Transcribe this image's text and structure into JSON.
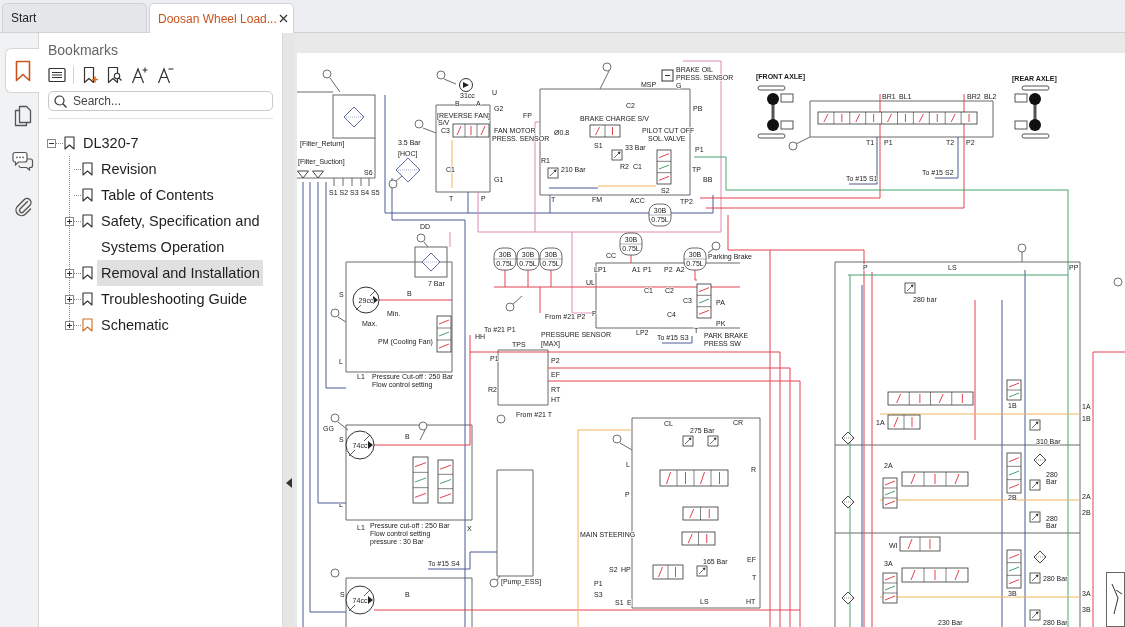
{
  "tabs": [
    {
      "label": "Start",
      "selected": false,
      "closable": false
    },
    {
      "label": "Doosan Wheel Load...",
      "selected": true,
      "closable": true
    }
  ],
  "sidebar_tabs": [
    {
      "kind": "bookmarks",
      "selected": true
    },
    {
      "kind": "pages",
      "selected": false
    },
    {
      "kind": "comments",
      "selected": false
    },
    {
      "kind": "attachments",
      "selected": false
    }
  ],
  "bookmarks": {
    "title": "Bookmarks",
    "search": {
      "placeholder": "Search..."
    },
    "tree": [
      {
        "label": "DL320-7",
        "expanded": true,
        "selected": false,
        "current": false,
        "children": [
          {
            "label": "Revision",
            "selected": false,
            "current": false
          },
          {
            "label": "Table of Contents",
            "selected": false,
            "current": false
          },
          {
            "label": "Safety, Specification and Systems Operation",
            "expanded": false,
            "selected": false,
            "current": false
          },
          {
            "label": "Removal and Installation",
            "expanded": false,
            "selected": true,
            "current": false
          },
          {
            "label": "Troubleshooting Guide",
            "expanded": false,
            "selected": false,
            "current": false
          },
          {
            "label": "Schematic",
            "expanded": false,
            "selected": false,
            "current": true
          }
        ]
      }
    ]
  },
  "document": {
    "labels": [
      "[Filter_Return]",
      "[Filter_Suction]",
      "S1 S2 S3 S4 S5",
      "S6",
      "3.5 Bar",
      "[HOC]",
      "31cc",
      "B",
      "A",
      "U",
      "[REVERSE FAN]",
      "S/V",
      "C3",
      "C1",
      "G1",
      "T",
      "P",
      "G2",
      "FAN MOTOR",
      "PRESS. SENSOR",
      "FP",
      "MSP",
      "BRAKE OIL",
      "PRESS. SENSOR",
      "G",
      "C2",
      "PB",
      "BRAKE CHARGE S/V",
      "Ø0.8",
      "PILOT CUT OFF",
      "SOL.VALVE",
      "S1",
      "33 Bar",
      "P1",
      "R1",
      "210 Bar",
      "R2",
      "C1",
      "TP",
      "BB",
      "S2",
      "T",
      "FM",
      "ACC",
      "TP2",
      "30B",
      "0.75L",
      "DD",
      "30B",
      "0.75L",
      "30B",
      "30B",
      "30B",
      "CC",
      "30B",
      "Parking Brake",
      "0.75L",
      "0.75L",
      "0.75L",
      "0.75L",
      "LP1",
      "A1",
      "P1",
      "P2",
      "A2",
      "7 Bar",
      "UL",
      "S",
      "B",
      "C1",
      "C2",
      "29cc",
      "C3",
      "PA",
      "Min.",
      "P",
      "C4",
      "From #21 P2",
      "Max.",
      "PK",
      "To #21 P1",
      "PM (Cooling Fan)",
      "HH",
      "PRESSURE SENSOR",
      "LP2",
      "To #15 S3",
      "T",
      "PARK BRAKE",
      "TPS",
      "[MAX]",
      "PRESS SW",
      "L",
      "P1",
      "P2",
      "L1",
      "Pressure Cut-off : 250 Bar",
      "EF",
      "Flow control setting",
      "R2",
      "RT",
      "HT",
      "From #21 T",
      "GG",
      "CL",
      "275 Bar",
      "CR",
      "S",
      "74cc",
      "B",
      "L",
      "R",
      "P",
      "L",
      "L1",
      "Pressure cut-off : 250 Bar",
      "X",
      "Flow control setting",
      "MAIN STEERING",
      "pressure : 30 Bar",
      "To #15 S4",
      "165 Bar",
      "EF",
      "S2",
      "HP",
      "[Pump_ESS]",
      "P1",
      "T",
      "S",
      "B",
      "S3",
      "74cc",
      "S1",
      "E",
      "LS",
      "HT",
      "[FRONT AXLE]",
      "[REAR AXLE]",
      "BR1",
      "BL1",
      "BR2",
      "BL2",
      "T1",
      "P1",
      "T2",
      "P2",
      "To #15 S2",
      "To #15 S1",
      "P",
      "LS",
      "PP",
      "280 bar",
      "1B",
      "1A",
      "1A",
      "1B",
      "310 Bar",
      "2A",
      "280",
      "Bar",
      "2B",
      "2A",
      "2B",
      "280",
      "Bar",
      "WI",
      "3A",
      "280 Bar",
      "3B",
      "3A",
      "3B",
      "230 Bar",
      "280 Bar"
    ]
  }
}
